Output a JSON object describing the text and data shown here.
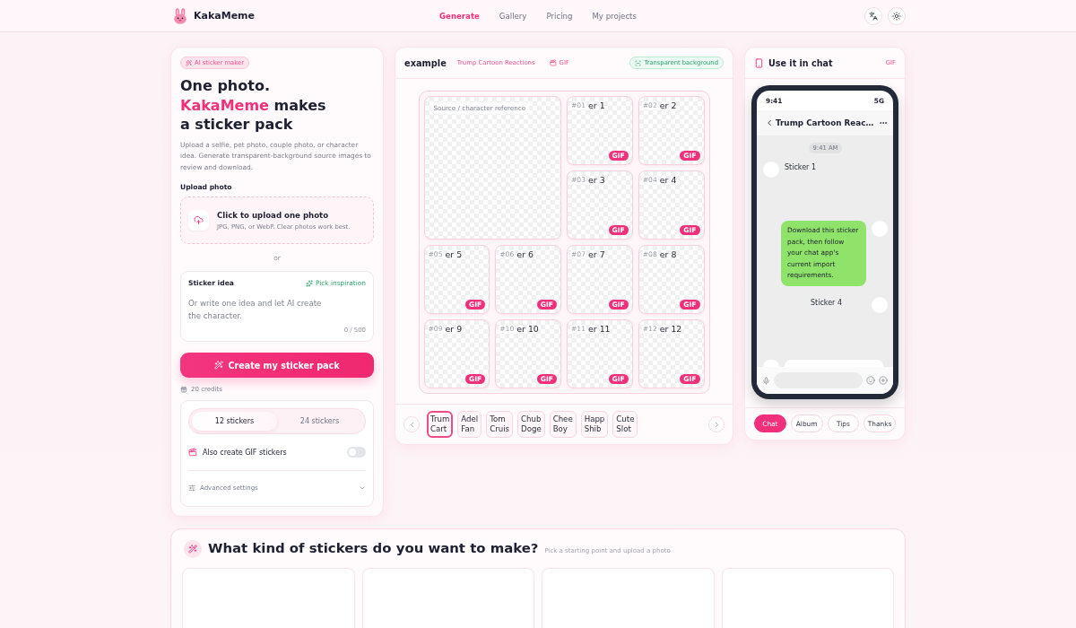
{
  "header": {
    "brand": "KakaMeme",
    "nav": [
      {
        "label": "Generate",
        "selected": true
      },
      {
        "label": "Gallery",
        "selected": false
      },
      {
        "label": "Pricing",
        "selected": false
      },
      {
        "label": "My projects",
        "selected": false
      }
    ]
  },
  "create_panel": {
    "badge": "AI sticker maker",
    "heading": {
      "before": "One photo.",
      "highlight": "KakaMeme",
      "after": "makes a sticker pack"
    },
    "description": "Upload a selfie, pet photo, couple photo, or character idea. Generate transparent-background source images to review and download.",
    "upload": {
      "label": "Upload photo",
      "title": "Click to upload one photo",
      "hint": "JPG, PNG, or WebP. Clear photos work best."
    },
    "separator": "or",
    "idea": {
      "label": "Sticker idea",
      "inspiration": "Pick inspiration",
      "placeholder": "Or write one idea and let AI create the character.",
      "counter": "0 / 500"
    },
    "create_button": "Create my sticker pack",
    "credits": "20 credits",
    "counts": [
      {
        "label": "12 stickers",
        "selected": true
      },
      {
        "label": "24 stickers",
        "selected": false
      }
    ],
    "gif_option": {
      "label": "Also create GIF stickers",
      "on": false
    },
    "advanced": {
      "label": "Advanced settings",
      "expanded": false
    }
  },
  "preview_panel": {
    "title": "example",
    "pack_name": "Trump Cartoon Reactions",
    "format": "GIF",
    "background_badge": "Transparent background",
    "source_tile": {
      "label": "Source / character reference"
    },
    "stickers": [
      {
        "number": "#01",
        "label": "er 1",
        "badge": "GIF"
      },
      {
        "number": "#02",
        "label": "er 2",
        "badge": "GIF"
      },
      {
        "number": "#03",
        "label": "er 3",
        "badge": "GIF"
      },
      {
        "number": "#04",
        "label": "er 4",
        "badge": "GIF"
      },
      {
        "number": "#05",
        "label": "er 5",
        "badge": "GIF"
      },
      {
        "number": "#06",
        "label": "er 6",
        "badge": "GIF"
      },
      {
        "number": "#07",
        "label": "er 7",
        "badge": "GIF"
      },
      {
        "number": "#08",
        "label": "er 8",
        "badge": "GIF"
      },
      {
        "number": "#09",
        "label": "er 9",
        "badge": "GIF"
      },
      {
        "number": "#10",
        "label": "er 10",
        "badge": "GIF"
      },
      {
        "number": "#11",
        "label": "er 11",
        "badge": "GIF"
      },
      {
        "number": "#12",
        "label": "er 12",
        "badge": "GIF"
      }
    ],
    "packs": [
      {
        "label": "Trum Cart",
        "selected": true
      },
      {
        "label": "Adel Fan",
        "selected": false
      },
      {
        "label": "Tom Cruis",
        "selected": false
      },
      {
        "label": "Chub Doge",
        "selected": false
      },
      {
        "label": "Chee Boy",
        "selected": false
      },
      {
        "label": "Happ Shib",
        "selected": false
      },
      {
        "label": "Cute Slot",
        "selected": false
      }
    ]
  },
  "chat_panel": {
    "title": "Use it in chat",
    "format": "GIF",
    "phone": {
      "time": "9:41",
      "network": "5G",
      "chat_title": "Trump Cartoon Reac…",
      "timestamp": "9:41 AM",
      "messages": [
        {
          "kind": "sticker",
          "outgoing": false,
          "text": "Sticker 1"
        },
        {
          "kind": "text",
          "outgoing": true,
          "text": "Download this sticker pack, then follow your chat app's current import requirements."
        },
        {
          "kind": "sticker",
          "outgoing": true,
          "text": "Sticker 4"
        },
        {
          "kind": "partial",
          "outgoing": false
        }
      ]
    },
    "tabs": [
      {
        "label": "Chat",
        "selected": true
      },
      {
        "label": "Album",
        "selected": false
      },
      {
        "label": "Tips",
        "selected": false
      },
      {
        "label": "Thanks",
        "selected": false
      }
    ]
  },
  "templates": {
    "title": "What kind of stickers do you want to make?",
    "subtitle": "Pick a starting point and upload a photo",
    "cards": [
      {
        "kind": "blank"
      },
      {
        "kind": "blank"
      },
      {
        "kind": "blank"
      },
      {
        "kind": "blank"
      }
    ]
  }
}
